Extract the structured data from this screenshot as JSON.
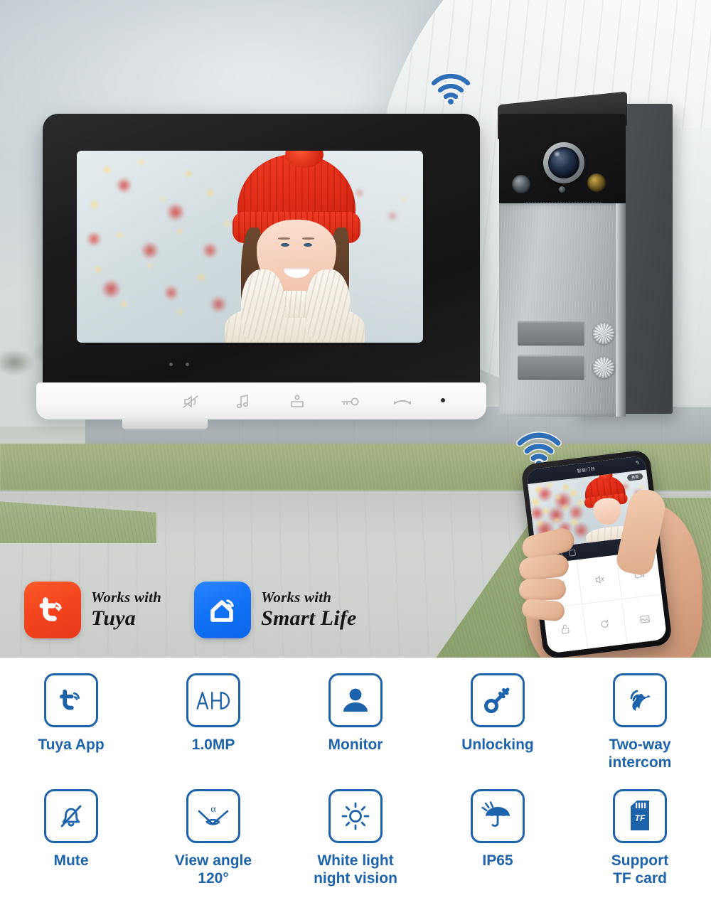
{
  "scene": {
    "monitor": {
      "name": "indoor-monitor",
      "buttons": [
        {
          "id": "mute",
          "icon": "mute-icon"
        },
        {
          "id": "melody",
          "icon": "music-note-icon"
        },
        {
          "id": "monitor",
          "icon": "monitor-icon"
        },
        {
          "id": "unlock",
          "icon": "key-icon"
        },
        {
          "id": "talk",
          "icon": "phone-handset-icon"
        }
      ]
    },
    "door_station": {
      "name": "outdoor-door-station",
      "call_buttons": 2,
      "nameplates": 2
    },
    "wifi_icons": [
      "wifi-icon",
      "wifi-icon"
    ],
    "phone": {
      "app_title": "智能门铃",
      "app_chip": "高清",
      "grid_icons": [
        "snapshot-icon",
        "mute-icon",
        "video-record-icon",
        "unlock-icon",
        "refresh-icon",
        "gallery-icon"
      ]
    }
  },
  "badges": [
    {
      "logo": "tuya-logo",
      "line1": "Works with",
      "line2": "Tuya",
      "color": "#f2441e"
    },
    {
      "logo": "smart-life-logo",
      "line1": "Works with",
      "line2": "Smart Life",
      "color": "#1272f5"
    }
  ],
  "features": {
    "accent_color": "#1d63ab",
    "row1": [
      {
        "icon": "tuya-app-icon",
        "label": "Tuya App"
      },
      {
        "icon": "ahd-icon",
        "label": "1.0MP"
      },
      {
        "icon": "person-icon",
        "label": "Monitor"
      },
      {
        "icon": "key-icon",
        "label": "Unlocking"
      },
      {
        "icon": "two-way-intercom-icon",
        "label": "Two-way\nintercom"
      }
    ],
    "row2": [
      {
        "icon": "mute-bell-icon",
        "label": "Mute"
      },
      {
        "icon": "view-angle-icon",
        "label": "View angle\n120°"
      },
      {
        "icon": "sun-icon",
        "label": "White light\nnight vision"
      },
      {
        "icon": "umbrella-rain-icon",
        "label": "IP65"
      },
      {
        "icon": "tf-card-icon",
        "label": "Support\nTF card"
      }
    ]
  }
}
